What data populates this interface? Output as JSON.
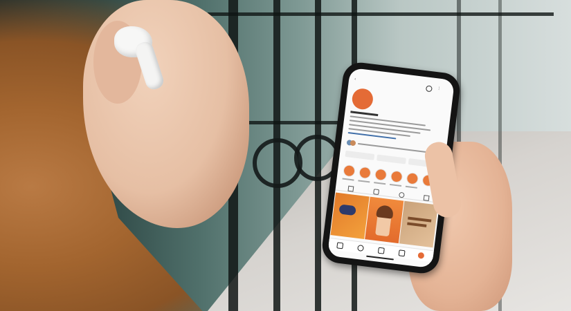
{
  "phone": {
    "status_time": "",
    "profile": {
      "username": "",
      "logo_text": "",
      "stats": [
        {
          "number": "",
          "label": ""
        },
        {
          "number": "",
          "label": ""
        },
        {
          "number": "",
          "label": ""
        }
      ]
    },
    "buttons": [
      {
        "label": ""
      },
      {
        "label": ""
      },
      {
        "label": ""
      }
    ],
    "highlight_count": 6,
    "grid_tiles": 3,
    "nav_icons": [
      "home-icon",
      "search-icon",
      "reels-icon",
      "shop-icon",
      "profile-icon"
    ]
  },
  "colors": {
    "brand_accent": "#e46b36",
    "highlight": "#e97a3a",
    "phone_case": "#141414",
    "earbud": "#f7f7f6"
  }
}
